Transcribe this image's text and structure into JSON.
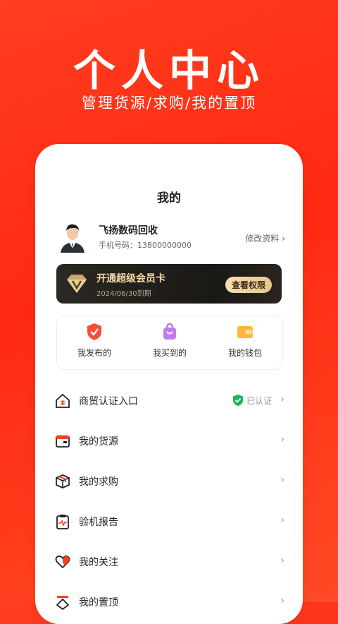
{
  "hero": {
    "title": "个人中心",
    "subtitle": "管理货源/求购/我的置顶"
  },
  "page": {
    "title": "我的"
  },
  "profile": {
    "name": "飞扬数码回收",
    "phone": "手机号码：13800000000",
    "edit_label": "修改资料"
  },
  "vip": {
    "title": "开通超级会员卡",
    "expiry": "2024/06/30到期",
    "button": "查看权限"
  },
  "quick_actions": [
    {
      "label": "我发布的",
      "icon": "shield-check-icon"
    },
    {
      "label": "我买到的",
      "icon": "shopping-bag-icon"
    },
    {
      "label": "我的钱包",
      "icon": "wallet-icon"
    }
  ],
  "menu": [
    {
      "label": "商贸认证入口",
      "status": "已认证",
      "icon": "store-house-icon"
    },
    {
      "label": "我的货源",
      "icon": "wallet-card-icon"
    },
    {
      "label": "我的求购",
      "icon": "package-box-icon"
    },
    {
      "label": "验机报告",
      "icon": "clipboard-report-icon"
    },
    {
      "label": "我的关注",
      "icon": "heart-icon"
    },
    {
      "label": "我的置顶",
      "icon": "pin-top-icon"
    }
  ],
  "chevron": "›",
  "colors": {
    "brand_red": "#ff2a12",
    "vip_gold": "#f3d9aa",
    "verified_green": "#1fb55a"
  }
}
